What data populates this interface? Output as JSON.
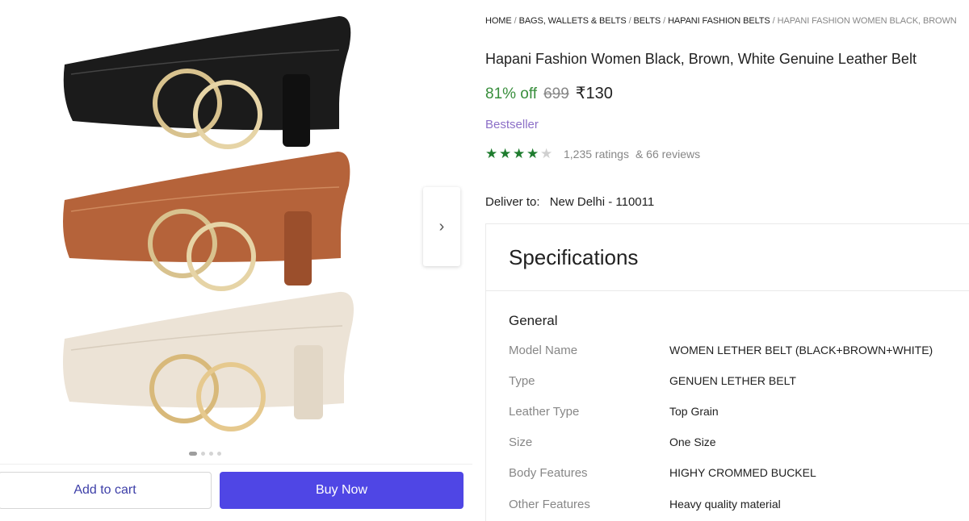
{
  "breadcrumb": [
    "HOME",
    "BAGS, WALLETS & BELTS",
    "BELTS",
    "HAPANI FASHION BELTS",
    "HAPANI FASHION WOMEN BLACK, BROWN"
  ],
  "product": {
    "title": "Hapani Fashion Women Black, Brown, White Genuine Leather Belt",
    "discount": "81% off",
    "mrp": "699",
    "price": "₹130",
    "badge": "Bestseller",
    "rating_stars": 4,
    "ratings": "1,235 ratings",
    "reviews": "& 66 reviews"
  },
  "delivery": {
    "label": "Deliver to:",
    "location": "New Delhi - 110011"
  },
  "gallery": {
    "slide_count": 4,
    "active_slide": 1,
    "belt_colors": [
      "#1b1b1b",
      "#b5633a",
      "#ece3d6"
    ]
  },
  "actions": {
    "add_to_cart": "Add to cart",
    "buy_now": "Buy Now"
  },
  "specifications": {
    "title": "Specifications",
    "group": "General",
    "rows": [
      {
        "key": "Model Name",
        "value": "WOMEN LETHER BELT (BLACK+BROWN+WHITE)"
      },
      {
        "key": "Type",
        "value": "GENUEN LETHER BELT"
      },
      {
        "key": "Leather Type",
        "value": "Top Grain"
      },
      {
        "key": "Size",
        "value": "One Size"
      },
      {
        "key": "Body Features",
        "value": "HIGHY CROMMED BUCKEL"
      },
      {
        "key": "Other Features",
        "value": "Heavy quality material"
      }
    ]
  },
  "colors": {
    "discount_green": "#388e3c",
    "buy_button": "#4f46e5",
    "bestseller": "#8c6fc7",
    "star_green": "#1e7c2e"
  }
}
